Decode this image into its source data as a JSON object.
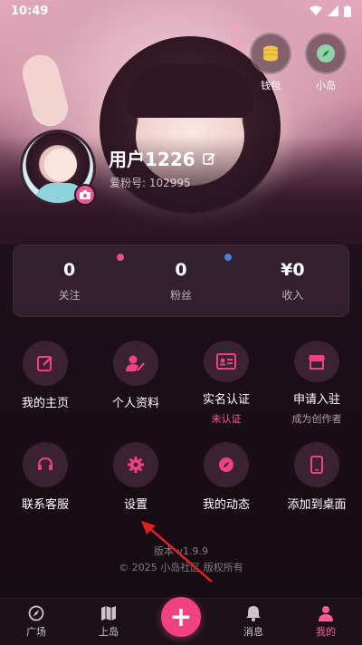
{
  "status_bar": {
    "time": "10:49"
  },
  "quick_actions": [
    {
      "label": "钱包",
      "icon": "coins-icon"
    },
    {
      "label": "小岛",
      "icon": "compass-icon"
    }
  ],
  "profile": {
    "username": "用户1226",
    "fan_id": "爱粉号: 102995"
  },
  "stats": [
    {
      "value": "0",
      "label": "关注"
    },
    {
      "value": "0",
      "label": "粉丝"
    },
    {
      "value": "¥0",
      "label": "收入"
    }
  ],
  "menu": [
    {
      "label": "我的主页",
      "sub": "",
      "icon": "edit-icon"
    },
    {
      "label": "个人资料",
      "sub": "",
      "icon": "user-edit-icon"
    },
    {
      "label": "实名认证",
      "sub": "未认证",
      "icon": "id-card-icon"
    },
    {
      "label": "申请入驻",
      "sub": "成为创作者",
      "icon": "store-icon"
    },
    {
      "label": "联系客服",
      "sub": "",
      "icon": "headset-icon"
    },
    {
      "label": "设置",
      "sub": "",
      "icon": "gear-icon"
    },
    {
      "label": "我的动态",
      "sub": "",
      "icon": "compass-icon"
    },
    {
      "label": "添加到桌面",
      "sub": "",
      "icon": "phone-icon"
    }
  ],
  "footer": {
    "version": "版本 v1.9.9",
    "copyright": "© 2025 小岛社区 版权所有"
  },
  "bottom_nav": [
    {
      "label": "广场",
      "icon": "compass-icon",
      "active": false
    },
    {
      "label": "上岛",
      "icon": "map-icon",
      "active": false
    },
    {
      "label": "消息",
      "icon": "bell-icon",
      "active": false
    },
    {
      "label": "我的",
      "icon": "person-icon",
      "active": true
    }
  ],
  "fab_label": "+",
  "colors": {
    "accent": "#f0427f",
    "sub_pink": "#ff5c97",
    "sub_gray": "#b89aa9",
    "dot_pink": "#e0508a",
    "dot_blue": "#4a7fd6"
  }
}
